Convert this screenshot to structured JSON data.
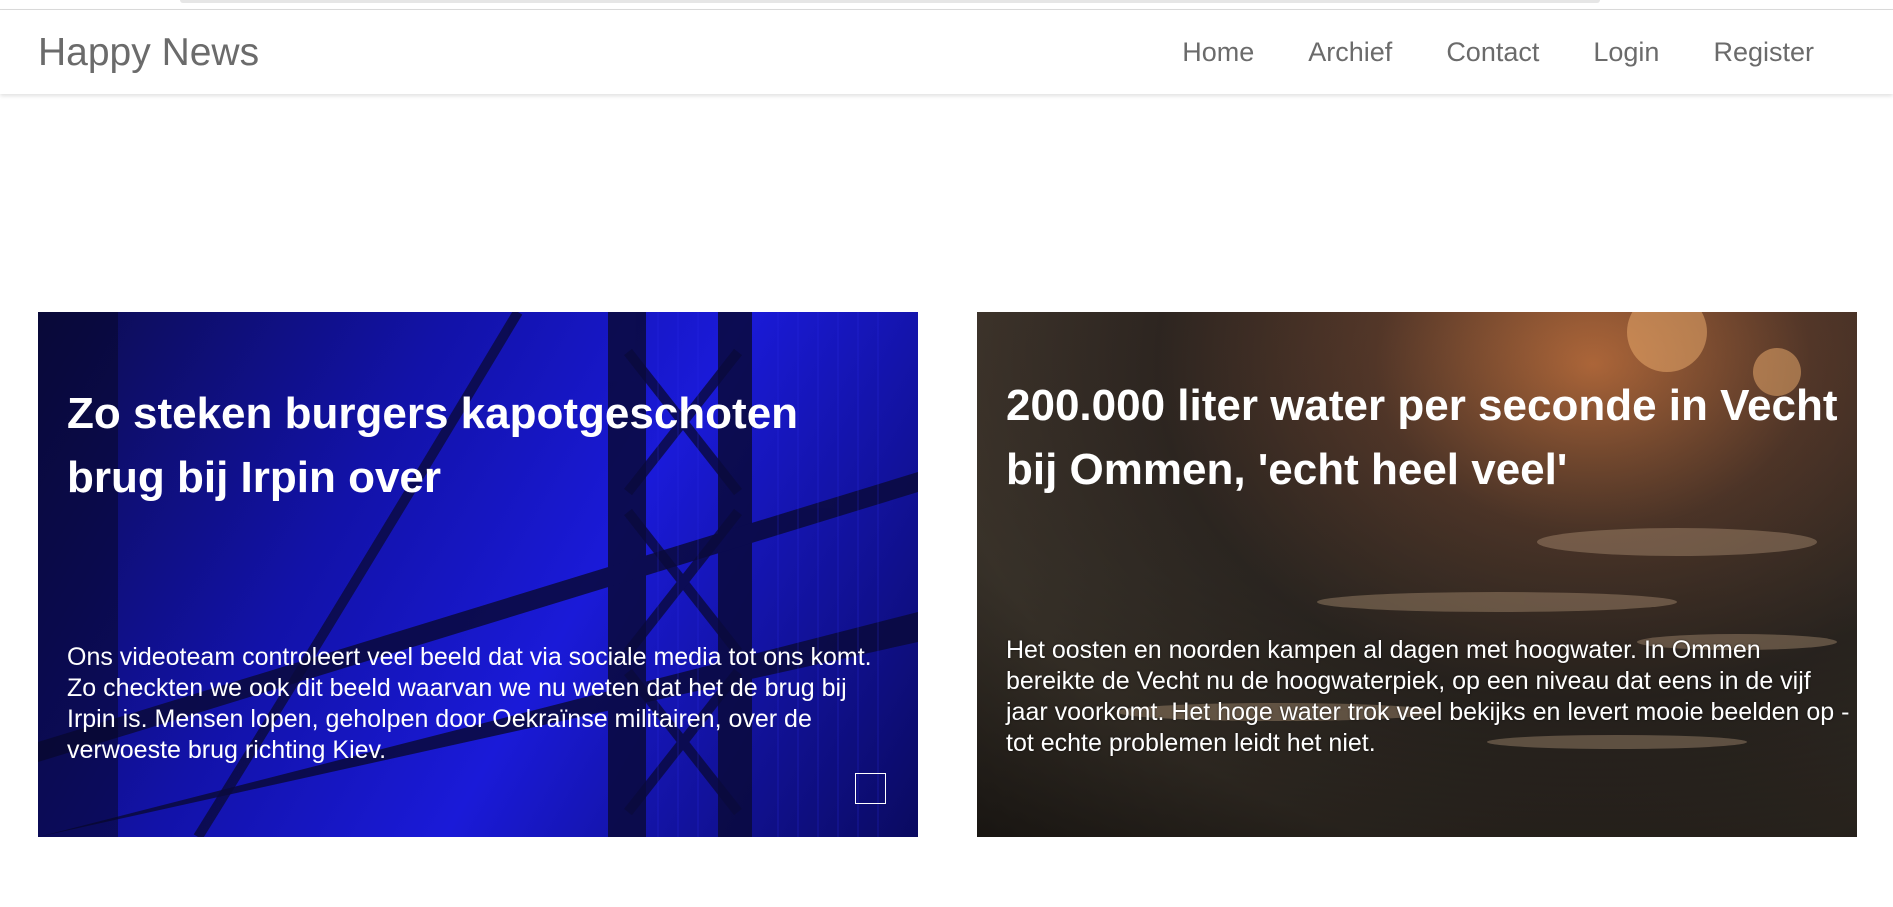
{
  "navbar": {
    "brand": "Happy News",
    "items": [
      {
        "label": "Home"
      },
      {
        "label": "Archief"
      },
      {
        "label": "Contact"
      },
      {
        "label": "Login"
      },
      {
        "label": "Register"
      }
    ]
  },
  "articles": [
    {
      "title": "Zo steken burgers kapotgeschoten brug bij Irpin over",
      "summary": "Ons videoteam controleert veel beeld dat via sociale media tot ons komt. Zo checkten we ook dit beeld waarvan we nu weten dat het de brug bij Irpin is. Mensen lopen, geholpen door Oekraïnse militairen, over de verwoeste brug richting Kiev.",
      "tint": "#1a1ad8"
    },
    {
      "title": "200.000 liter water per seconde in Vecht bij Ommen, 'echt heel veel'",
      "summary": "Het oosten en noorden kampen al dagen met hoogwater. In Ommen bereikte de Vecht nu de hoogwaterpiek, op een niveau dat eens in de vijf jaar voorkomt. Het hoge water trok veel bekijks en levert mooie beelden op - tot echte problemen leidt het niet."
    }
  ]
}
